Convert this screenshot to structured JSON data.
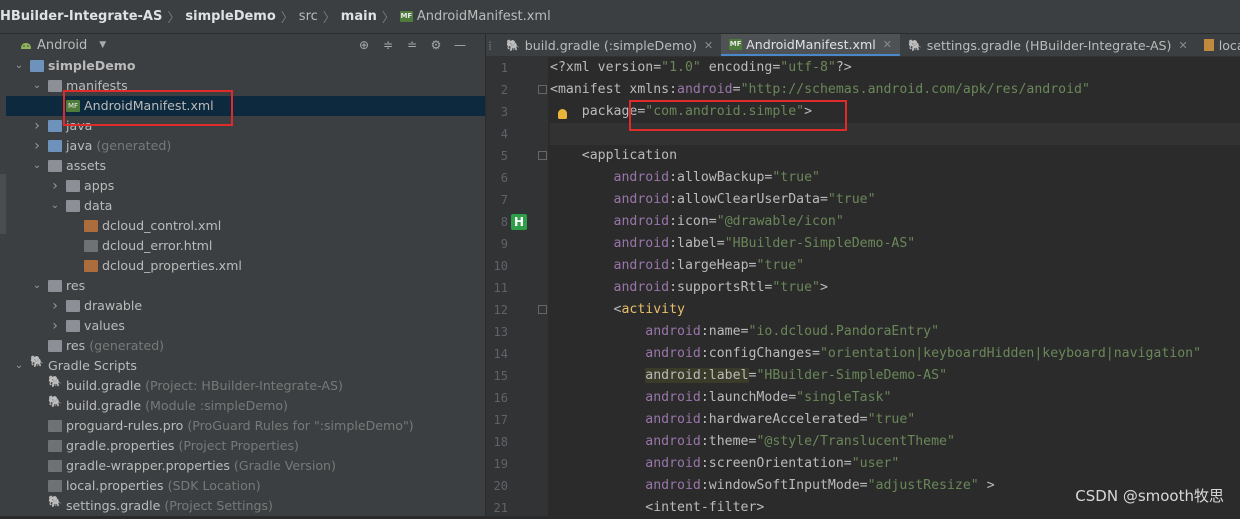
{
  "breadcrumb": [
    {
      "label": "HBuilder-Integrate-AS",
      "bold": true
    },
    {
      "label": "simpleDemo",
      "bold": true
    },
    {
      "label": "src",
      "bold": false
    },
    {
      "label": "main",
      "bold": true
    },
    {
      "label": "AndroidManifest.xml",
      "bold": false,
      "badge": "MF"
    }
  ],
  "project_panel": {
    "view_selector": "Android",
    "tools": [
      "target-icon",
      "expand-all-icon",
      "collapse-all-icon",
      "gear-icon",
      "minimize-icon"
    ],
    "tree": [
      {
        "label": "simpleDemo",
        "hint": "",
        "bold": true,
        "icon": "module-folder",
        "arrow": "down"
      },
      {
        "label": "manifests",
        "hint": "",
        "icon": "folder",
        "arrow": "down"
      },
      {
        "label": "AndroidManifest.xml",
        "hint": "",
        "icon": "manifest-file",
        "arrow": "",
        "selected": true
      },
      {
        "label": "java",
        "hint": "",
        "icon": "source-folder",
        "arrow": "right"
      },
      {
        "label": "java",
        "hint": "(generated)",
        "icon": "source-folder",
        "arrow": "right"
      },
      {
        "label": "assets",
        "hint": "",
        "icon": "folder",
        "arrow": "down"
      },
      {
        "label": "apps",
        "hint": "",
        "icon": "folder",
        "arrow": "right"
      },
      {
        "label": "data",
        "hint": "",
        "icon": "folder",
        "arrow": "down"
      },
      {
        "label": "dcloud_control.xml",
        "hint": "",
        "icon": "xml-file",
        "arrow": ""
      },
      {
        "label": "dcloud_error.html",
        "hint": "",
        "icon": "html-file",
        "arrow": ""
      },
      {
        "label": "dcloud_properties.xml",
        "hint": "",
        "icon": "xml-file",
        "arrow": ""
      },
      {
        "label": "res",
        "hint": "",
        "icon": "folder",
        "arrow": "down"
      },
      {
        "label": "drawable",
        "hint": "",
        "icon": "folder",
        "arrow": "right"
      },
      {
        "label": "values",
        "hint": "",
        "icon": "folder",
        "arrow": "right"
      },
      {
        "label": "res",
        "hint": "(generated)",
        "icon": "folder",
        "arrow": ""
      },
      {
        "label": "Gradle Scripts",
        "hint": "",
        "icon": "gradle",
        "arrow": "down"
      },
      {
        "label": "build.gradle",
        "hint": "(Project: HBuilder-Integrate-AS)",
        "icon": "gradle",
        "arrow": ""
      },
      {
        "label": "build.gradle",
        "hint": "(Module :simpleDemo)",
        "icon": "gradle",
        "arrow": ""
      },
      {
        "label": "proguard-rules.pro",
        "hint": "(ProGuard Rules for \":simpleDemo\")",
        "icon": "text-file",
        "arrow": ""
      },
      {
        "label": "gradle.properties",
        "hint": "(Project Properties)",
        "icon": "properties-file",
        "arrow": ""
      },
      {
        "label": "gradle-wrapper.properties",
        "hint": "(Gradle Version)",
        "icon": "properties-file",
        "arrow": ""
      },
      {
        "label": "local.properties",
        "hint": "(SDK Location)",
        "icon": "properties-file",
        "arrow": ""
      },
      {
        "label": "settings.gradle",
        "hint": "(Project Settings)",
        "icon": "gradle",
        "arrow": ""
      }
    ]
  },
  "tabs": [
    {
      "label": "build.gradle (:simpleDemo)",
      "icon": "gradle",
      "active": false
    },
    {
      "label": "AndroidManifest.xml",
      "icon": "manifest-file",
      "active": true
    },
    {
      "label": "settings.gradle (HBuilder-Integrate-AS)",
      "icon": "gradle",
      "active": false
    },
    {
      "label": "local.pr",
      "icon": "properties-file",
      "active": false
    }
  ],
  "editor": {
    "line_numbers": [
      "1",
      "2",
      "3",
      "4",
      "5",
      "6",
      "7",
      "8",
      "9",
      "10",
      "11",
      "12",
      "13",
      "14",
      "15",
      "16",
      "17",
      "18",
      "19",
      "20",
      "21"
    ],
    "lines": [
      [
        [
          "d",
          "<?xml version="
        ],
        [
          "v",
          "\"1.0\""
        ],
        [
          "d",
          " encoding="
        ],
        [
          "v",
          "\"utf-8\""
        ],
        [
          "d",
          "?>"
        ]
      ],
      [
        [
          "d",
          "<manifest xmlns:"
        ],
        [
          "n",
          "android"
        ],
        [
          "d",
          "="
        ],
        [
          "v",
          "\"http://schemas.android.com/apk/res/android\""
        ]
      ],
      [
        [
          "d",
          "    package="
        ],
        [
          "v",
          "\"com.android.simple\""
        ],
        [
          "d",
          ">"
        ]
      ],
      [],
      [
        [
          "d",
          "    <application"
        ]
      ],
      [
        [
          "d",
          "        "
        ],
        [
          "n",
          "android"
        ],
        [
          "d",
          ":allowBackup="
        ],
        [
          "v",
          "\"true\""
        ]
      ],
      [
        [
          "d",
          "        "
        ],
        [
          "n",
          "android"
        ],
        [
          "d",
          ":allowClearUserData="
        ],
        [
          "v",
          "\"true\""
        ]
      ],
      [
        [
          "d",
          "        "
        ],
        [
          "n",
          "android"
        ],
        [
          "d",
          ":icon="
        ],
        [
          "v",
          "\"@drawable/icon\""
        ]
      ],
      [
        [
          "d",
          "        "
        ],
        [
          "n",
          "android"
        ],
        [
          "d",
          ":label="
        ],
        [
          "v",
          "\"HBuilder-SimpleDemo-AS\""
        ]
      ],
      [
        [
          "d",
          "        "
        ],
        [
          "n",
          "android"
        ],
        [
          "d",
          ":largeHeap="
        ],
        [
          "v",
          "\"true\""
        ]
      ],
      [
        [
          "d",
          "        "
        ],
        [
          "n",
          "android"
        ],
        [
          "d",
          ":supportsRtl="
        ],
        [
          "v",
          "\"true\""
        ],
        [
          "d",
          ">"
        ]
      ],
      [
        [
          "d",
          "        <"
        ],
        [
          "t",
          "activity"
        ]
      ],
      [
        [
          "d",
          "            "
        ],
        [
          "n",
          "android"
        ],
        [
          "d",
          ":name="
        ],
        [
          "v",
          "\"io.dcloud.PandoraEntry\""
        ]
      ],
      [
        [
          "d",
          "            "
        ],
        [
          "n",
          "android"
        ],
        [
          "d",
          ":configChanges="
        ],
        [
          "v",
          "\"orientation|keyboardHidden|keyboard|navigation\""
        ]
      ],
      [
        [
          "d",
          "            "
        ],
        [
          "h",
          "android:label"
        ],
        [
          "d",
          "="
        ],
        [
          "v",
          "\"HBuilder-SimpleDemo-AS\""
        ]
      ],
      [
        [
          "d",
          "            "
        ],
        [
          "n",
          "android"
        ],
        [
          "d",
          ":launchMode="
        ],
        [
          "v",
          "\"singleTask\""
        ]
      ],
      [
        [
          "d",
          "            "
        ],
        [
          "n",
          "android"
        ],
        [
          "d",
          ":hardwareAccelerated="
        ],
        [
          "v",
          "\"true\""
        ]
      ],
      [
        [
          "d",
          "            "
        ],
        [
          "n",
          "android"
        ],
        [
          "d",
          ":theme="
        ],
        [
          "v",
          "\"@style/TranslucentTheme\""
        ]
      ],
      [
        [
          "d",
          "            "
        ],
        [
          "n",
          "android"
        ],
        [
          "d",
          ":screenOrientation="
        ],
        [
          "v",
          "\"user\""
        ]
      ],
      [
        [
          "d",
          "            "
        ],
        [
          "n",
          "android"
        ],
        [
          "d",
          ":windowSoftInputMode="
        ],
        [
          "v",
          "\"adjustResize\""
        ],
        [
          "d",
          " >"
        ]
      ],
      [
        [
          "d",
          "            <intent-filter>"
        ]
      ]
    ]
  },
  "gutter_badge": "H",
  "watermark": "CSDN @smooth牧思"
}
